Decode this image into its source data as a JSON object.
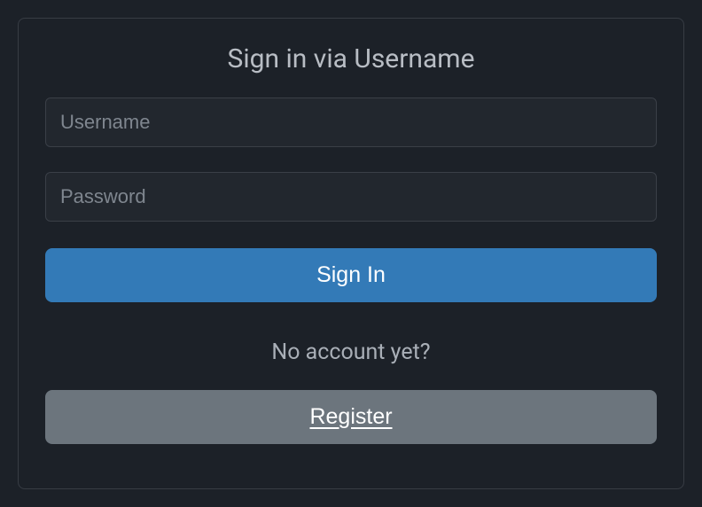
{
  "login": {
    "title": "Sign in via Username",
    "username_placeholder": "Username",
    "password_placeholder": "Password",
    "signin_label": "Sign In",
    "no_account_text": "No account yet?",
    "register_label": "Register"
  }
}
